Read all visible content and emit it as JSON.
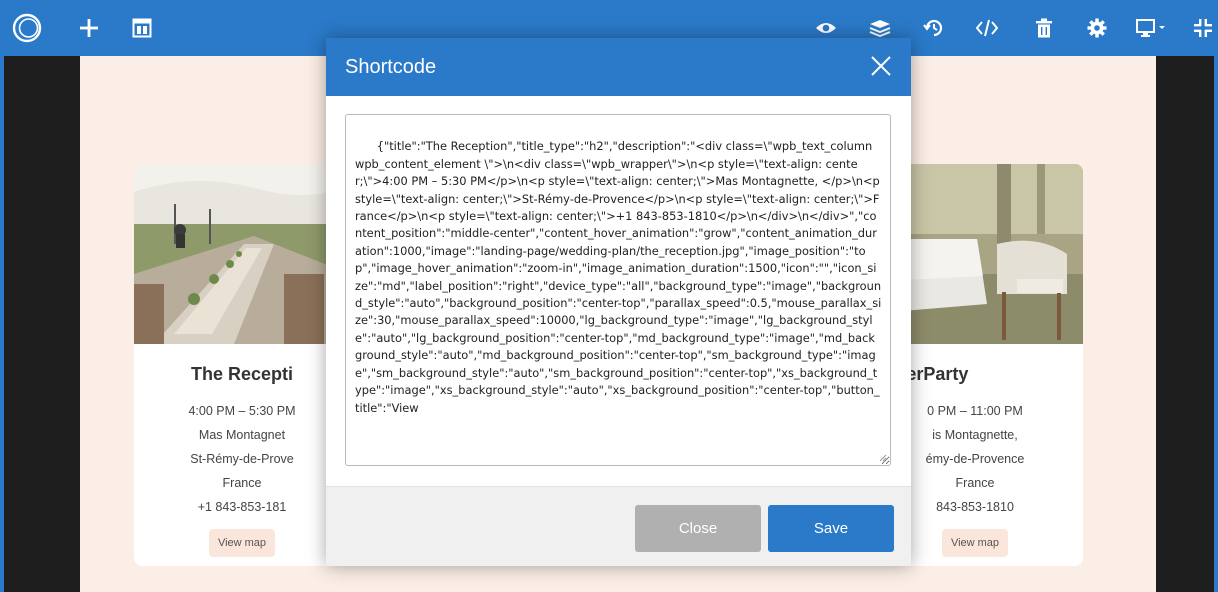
{
  "toolbar": {
    "left_icons": [
      "logo-icon",
      "add-icon",
      "layout-icon"
    ],
    "right_icons": [
      "preview-eye-icon",
      "layers-icon",
      "history-icon",
      "code-icon",
      "trash-icon",
      "settings-gear-icon",
      "responsive-display-icon",
      "collapse-icon"
    ],
    "accent": "#2a7ac9"
  },
  "cards": {
    "left": {
      "title": "The Recepti",
      "lines": [
        "4:00 PM – 5:30 PM",
        "Mas Montagnet",
        "St-Rémy-de-Prove",
        "France",
        "+1 843-853-181"
      ],
      "button": "View map"
    },
    "right": {
      "title": "e AfterParty",
      "lines": [
        "0 PM – 11:00 PM",
        "is Montagnette,",
        "émy-de-Provence",
        "France",
        "843-853-1810"
      ],
      "button": "View map"
    }
  },
  "modal": {
    "title": "Shortcode",
    "code": "{\"title\":\"The Reception\",\"title_type\":\"h2\",\"description\":\"<div class=\\\"wpb_text_column wpb_content_element \\\">\\n<div class=\\\"wpb_wrapper\\\">\\n<p style=\\\"text-align: center;\\\">4:00 PM – 5:30 PM</p>\\n<p style=\\\"text-align: center;\\\">Mas Montagnette, </p>\\n<p style=\\\"text-align: center;\\\">St-Rémy-de-Provence</p>\\n<p style=\\\"text-align: center;\\\">France</p>\\n<p style=\\\"text-align: center;\\\">+1 843-853-1810</p>\\n</div>\\n</div>\",\"content_position\":\"middle-center\",\"content_hover_animation\":\"grow\",\"content_animation_duration\":1000,\"image\":\"landing-page/wedding-plan/the_reception.jpg\",\"image_position\":\"top\",\"image_hover_animation\":\"zoom-in\",\"image_animation_duration\":1500,\"icon\":\"\",\"icon_size\":\"md\",\"label_position\":\"right\",\"device_type\":\"all\",\"background_type\":\"image\",\"background_style\":\"auto\",\"background_position\":\"center-top\",\"parallax_speed\":0.5,\"mouse_parallax_size\":30,\"mouse_parallax_speed\":10000,\"lg_background_type\":\"image\",\"lg_background_style\":\"auto\",\"lg_background_position\":\"center-top\",\"md_background_type\":\"image\",\"md_background_style\":\"auto\",\"md_background_position\":\"center-top\",\"sm_background_type\":\"image\",\"sm_background_style\":\"auto\",\"sm_background_position\":\"center-top\",\"xs_background_type\":\"image\",\"xs_background_style\":\"auto\",\"xs_background_position\":\"center-top\",\"button_title\":\"View",
    "close_label": "Close",
    "save_label": "Save"
  }
}
